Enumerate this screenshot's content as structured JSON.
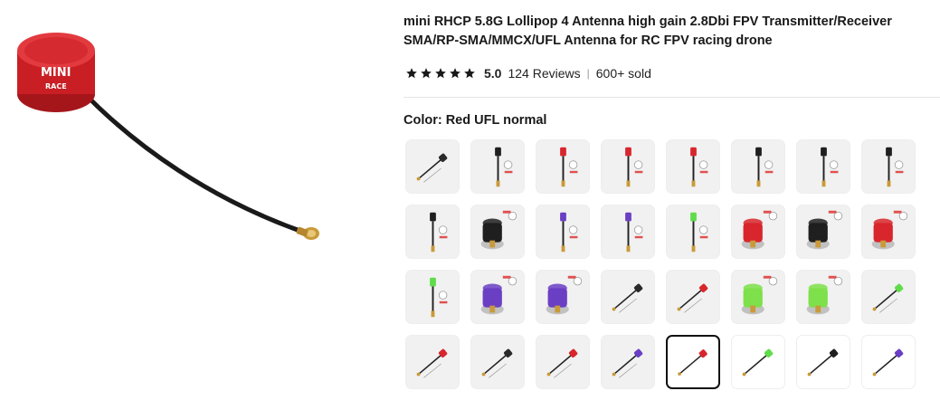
{
  "product": {
    "title": "mini RHCP 5.8G Lollipop 4 Antenna high gain 2.8Dbi FPV Transmitter/Receiver SMA/RP-SMA/MMCX/UFL Antenna for RC FPV racing drone",
    "rating": "5.0",
    "stars": 5,
    "reviews": "124 Reviews",
    "separator": "|",
    "sold": "600+ sold"
  },
  "main_image": {
    "logo_text": "MINI",
    "subtext": "RACE",
    "colors": {
      "cap": "#c81e24",
      "cable": "#1a1a1a",
      "connector": "#c99a3a"
    }
  },
  "color_selector": {
    "label": "Color: Red UFL normal",
    "selected_index": 28,
    "swatches": [
      {
        "type": "diag",
        "color": "#2a2a2a"
      },
      {
        "type": "stick",
        "color": "#1f1f1f",
        "badge": "label"
      },
      {
        "type": "stick",
        "color": "#d8262c",
        "badge": "label"
      },
      {
        "type": "stick",
        "color": "#d8262c",
        "badge": "label"
      },
      {
        "type": "stick",
        "color": "#d8262c",
        "badge": "label"
      },
      {
        "type": "stick",
        "color": "#1f1f1f",
        "badge": "label"
      },
      {
        "type": "stick",
        "color": "#1f1f1f",
        "badge": "label"
      },
      {
        "type": "stick",
        "color": "#1f1f1f",
        "badge": "label"
      },
      {
        "type": "stick",
        "color": "#1f1f1f",
        "badge": "label"
      },
      {
        "type": "cap",
        "color": "#1f1f1f",
        "tag": "SMA"
      },
      {
        "type": "stick",
        "color": "#6a3fc4",
        "badge": "label"
      },
      {
        "type": "stick",
        "color": "#6a3fc4",
        "badge": "label"
      },
      {
        "type": "stick",
        "color": "#5fdc4a",
        "badge": "label"
      },
      {
        "type": "cap",
        "color": "#d8262c",
        "tag": "SMA"
      },
      {
        "type": "cap",
        "color": "#1f1f1f",
        "tag": "RP-SMA"
      },
      {
        "type": "cap",
        "color": "#d8262c",
        "tag": "RP-SMA"
      },
      {
        "type": "stick",
        "color": "#5fdc4a",
        "badge": "label"
      },
      {
        "type": "cap",
        "color": "#6a3fc4",
        "tag": "SMA"
      },
      {
        "type": "cap",
        "color": "#6a3fc4",
        "tag": "RP-SMA"
      },
      {
        "type": "diag",
        "color": "#2a2a2a"
      },
      {
        "type": "diag",
        "color": "#d8262c"
      },
      {
        "type": "cap",
        "color": "#7ee04a",
        "tag": "RP-SMA"
      },
      {
        "type": "cap",
        "color": "#7ee04a",
        "tag": "SMA"
      },
      {
        "type": "diag",
        "color": "#5fdc4a"
      },
      {
        "type": "diag",
        "color": "#d8262c"
      },
      {
        "type": "diag",
        "color": "#2a2a2a"
      },
      {
        "type": "diag",
        "color": "#d8262c"
      },
      {
        "type": "diag",
        "color": "#6a3fc4"
      },
      {
        "type": "diagw",
        "color": "#d8262c"
      },
      {
        "type": "diagw",
        "color": "#5fdc4a"
      },
      {
        "type": "diagw",
        "color": "#1f1f1f"
      },
      {
        "type": "diagw",
        "color": "#6a3fc4"
      }
    ]
  }
}
